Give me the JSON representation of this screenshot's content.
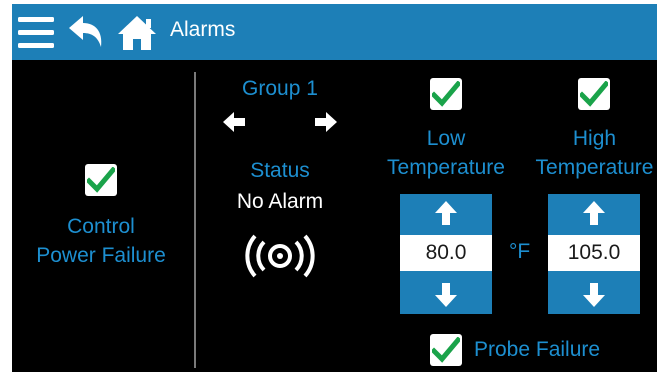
{
  "header": {
    "title": "Alarms",
    "icons": [
      "menu-icon",
      "back-icon",
      "home-icon"
    ],
    "color": "#1d7fb7"
  },
  "left_panel": {
    "control_power_failure_checked": true,
    "label_line1": "Control",
    "label_line2": "Power Failure"
  },
  "group": {
    "title": "Group 1",
    "prev_icon": "arrow-left-icon",
    "next_icon": "arrow-right-icon",
    "status_label": "Status",
    "status_value": "No Alarm",
    "alarm_icon": "alarm-signal-icon"
  },
  "low_temp": {
    "checked": true,
    "label_line1": "Low",
    "label_line2": "Temperature",
    "value": "80.0"
  },
  "high_temp": {
    "checked": true,
    "label_line1": "High",
    "label_line2": "Temperature",
    "value": "105.0"
  },
  "unit": "°F",
  "probe_failure": {
    "checked": true,
    "label": "Probe Failure"
  },
  "colors": {
    "accent": "#1d8fd0",
    "check": "#1aa34a",
    "background": "#000000"
  }
}
